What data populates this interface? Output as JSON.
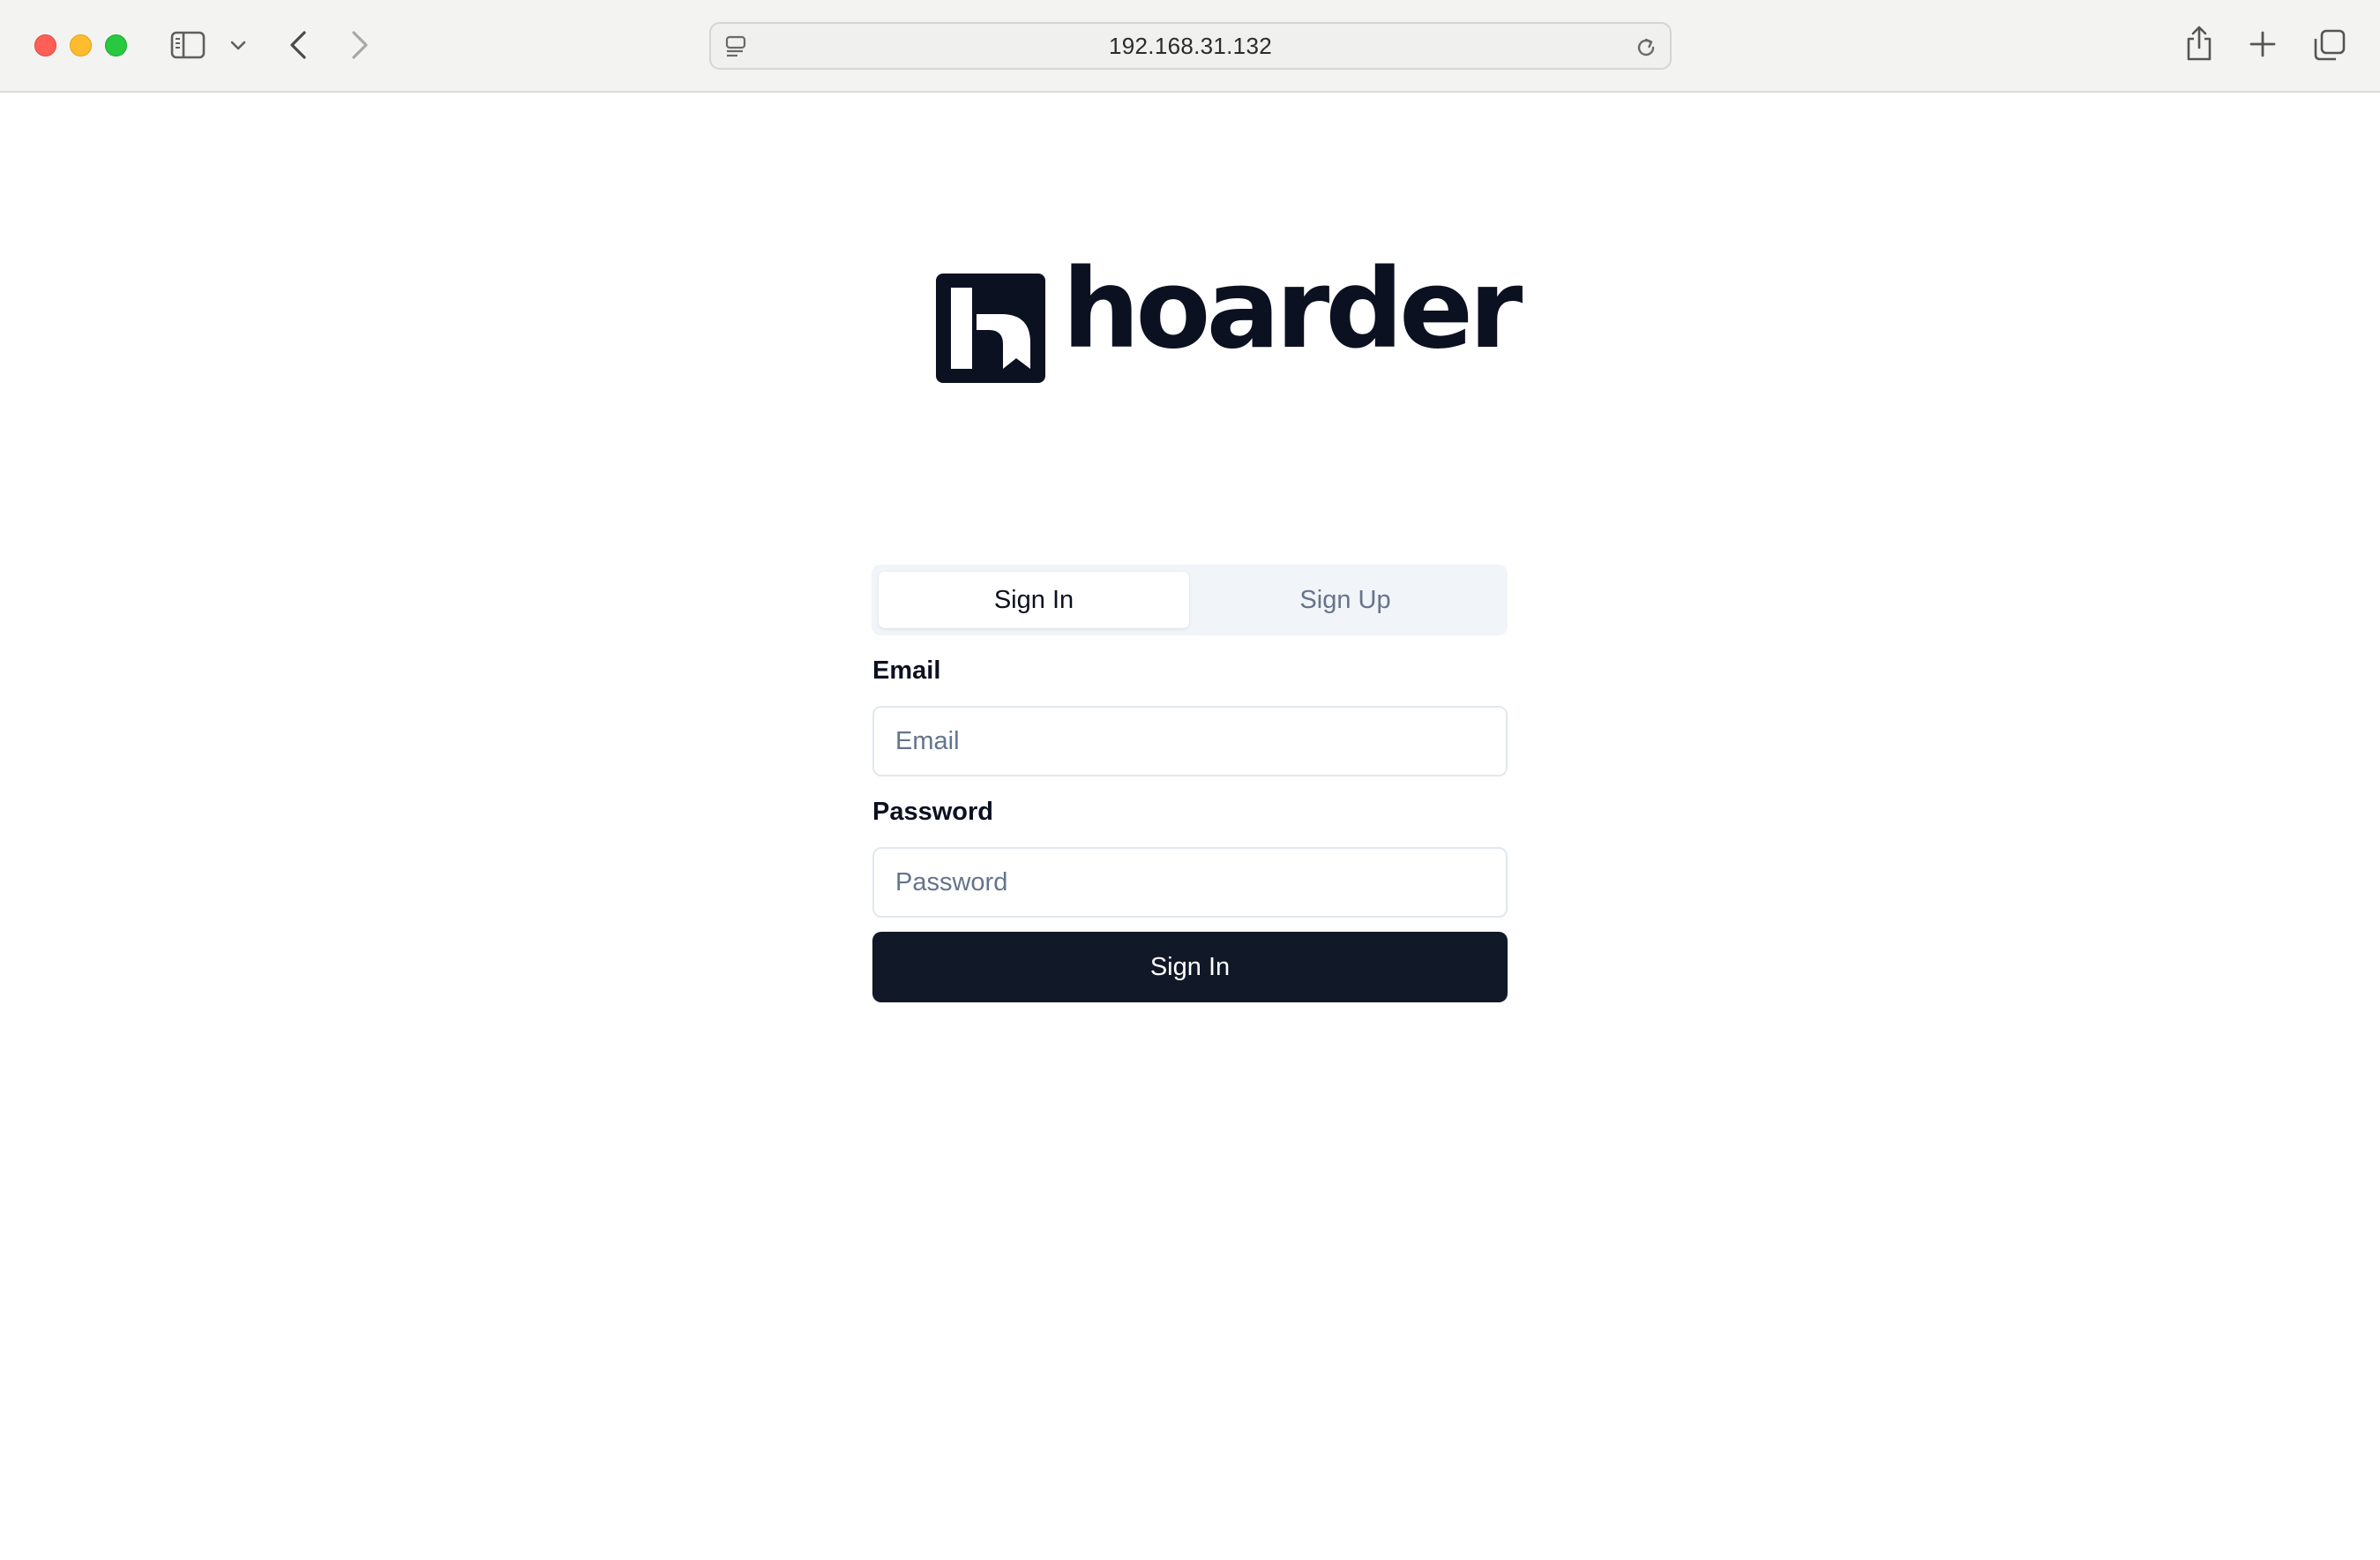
{
  "browser": {
    "url": "192.168.31.132",
    "icons": [
      "sidebar-icon",
      "chevron-down-icon",
      "back-arrow-icon",
      "forward-arrow-icon",
      "page-icon",
      "reload-icon",
      "share-icon",
      "plus-icon",
      "tabs-icon"
    ]
  },
  "brand": {
    "name": "hoarder",
    "color": "#0b1121"
  },
  "auth": {
    "tabs": [
      {
        "label": "Sign In",
        "active": true
      },
      {
        "label": "Sign Up",
        "active": false
      }
    ],
    "email": {
      "label": "Email",
      "placeholder": "Email",
      "value": ""
    },
    "password": {
      "label": "Password",
      "placeholder": "Password",
      "value": ""
    },
    "submit_label": "Sign In",
    "submit_color": "#111827"
  }
}
